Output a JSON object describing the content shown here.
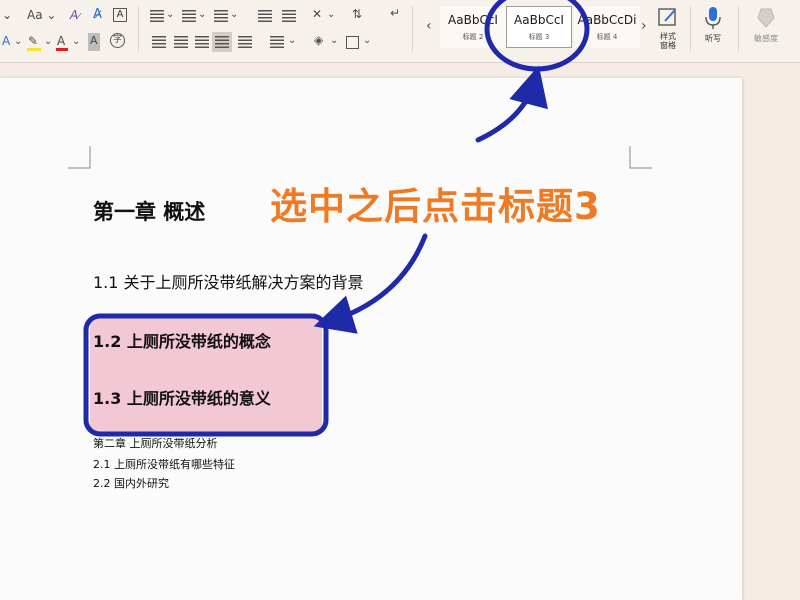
{
  "ribbon": {
    "font_size_label": "Aa",
    "font_case_label": "Aa",
    "styles": [
      {
        "preview": "AaBbCcI",
        "name": "标题 2"
      },
      {
        "preview": "AaBbCcI",
        "name": "标题 3"
      },
      {
        "preview": "AaBbCcDi",
        "name": "标题 4"
      }
    ],
    "styles_pane_label_1": "样式",
    "styles_pane_label_2": "窗格",
    "dictate_label": "听写",
    "sensitivity_label": "敏感度",
    "gallery_left_arrow": "‹",
    "gallery_right_arrow": "›"
  },
  "document": {
    "lines": [
      {
        "text": "第一章  概述"
      },
      {
        "text": "1.1 关于上厕所没带纸解决方案的背景"
      },
      {
        "text": "1.2 上厕所没带纸的概念"
      },
      {
        "text": "1.3 上厕所没带纸的意义"
      },
      {
        "text": "第二章  上厕所没带纸分析"
      },
      {
        "text": "2.1  上厕所没带纸有哪些特征"
      },
      {
        "text": "2.2  国内外研究"
      }
    ]
  },
  "annotation": {
    "text": "选中之后点击标题3",
    "color": "#ef7a24",
    "circle_color": "#1f2aa8",
    "highlight_color": "#f2c8d4"
  }
}
